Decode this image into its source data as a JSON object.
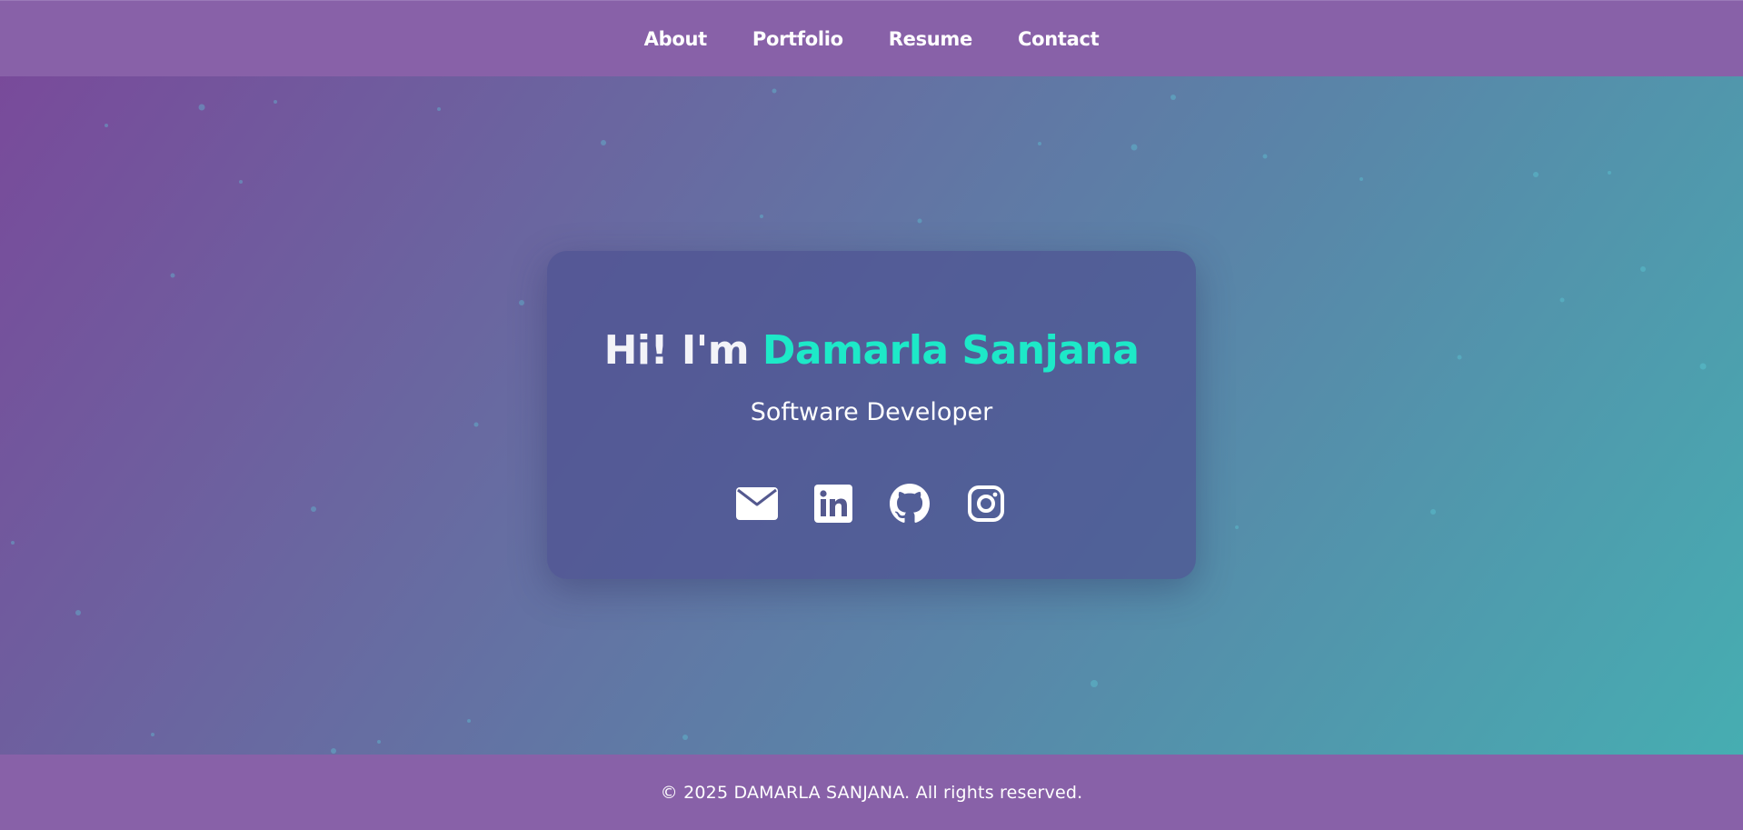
{
  "nav": {
    "items": [
      {
        "label": "About"
      },
      {
        "label": "Portfolio"
      },
      {
        "label": "Resume"
      },
      {
        "label": "Contact"
      }
    ]
  },
  "hero": {
    "greeting": "Hi! I'm ",
    "name": "Damarla Sanjana",
    "role": "Software Developer",
    "socials": [
      {
        "icon": "envelope-icon"
      },
      {
        "icon": "linkedin-icon"
      },
      {
        "icon": "github-icon"
      },
      {
        "icon": "instagram-icon"
      }
    ]
  },
  "footer": {
    "text": "© 2025 DAMARLA SANJANA. All rights reserved."
  },
  "colors": {
    "nav_bg": "#8861a8",
    "accent": "#1de9c8",
    "card_bg": "#54598f",
    "gradient_start": "#7a489a",
    "gradient_end": "#45b0b2"
  }
}
